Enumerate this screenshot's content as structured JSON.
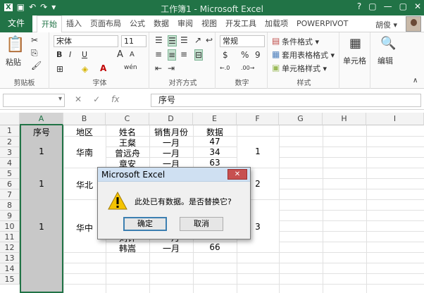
{
  "window": {
    "title": "工作簿1 - Microsoft Excel",
    "qat_icons": [
      "excel-logo-icon",
      "save-icon",
      "undo-icon",
      "redo-icon",
      "customize-icon"
    ],
    "controls": [
      "?",
      "▢",
      "—",
      "▢",
      "✕"
    ]
  },
  "ribbon_tabs": {
    "file": "文件",
    "tabs": [
      "开始",
      "插入",
      "页面布局",
      "公式",
      "数据",
      "审阅",
      "视图",
      "开发工具",
      "加载项",
      "POWERPIVOT"
    ],
    "active": "开始",
    "user": "胡俊 ▾"
  },
  "ribbon": {
    "clipboard": {
      "paste_label": "粘贴",
      "group_label": "剪贴板"
    },
    "font": {
      "font_name": "宋体",
      "font_size": "11",
      "bold": "B",
      "italic": "I",
      "underline": "U",
      "grow": "A",
      "shrink": "A",
      "wen": "wén",
      "group_label": "字体"
    },
    "alignment": {
      "group_label": "对齐方式"
    },
    "number": {
      "format": "常规",
      "currency": "$",
      "percent": "%",
      "comma": "9",
      "inc": "←.0",
      "dec": ".00→",
      "group_label": "数字"
    },
    "styles": {
      "conditional": "条件格式 ▾",
      "table": "套用表格格式 ▾",
      "cell_styles": "单元格样式 ▾",
      "group_label": "样式"
    },
    "cells": {
      "label": "单元格"
    },
    "editing": {
      "label": "编辑"
    }
  },
  "formula_bar": {
    "name_box": "",
    "cancel": "✕",
    "enter": "✓",
    "fx": "fx",
    "content": "序号"
  },
  "sheet": {
    "columns": [
      "A",
      "B",
      "C",
      "D",
      "E",
      "F",
      "G",
      "H",
      "I"
    ],
    "rows": [
      "1",
      "2",
      "3",
      "4",
      "5",
      "6",
      "7",
      "8",
      "9",
      "10",
      "11",
      "12",
      "13",
      "14",
      "15"
    ],
    "header_row": [
      "序号",
      "地区",
      "姓名",
      "销售月份",
      "数据"
    ],
    "merged_cells": [
      {
        "col": "A",
        "value": "1"
      },
      {
        "col": "A",
        "value": "1"
      },
      {
        "col": "A",
        "value": "1"
      },
      {
        "col": "B",
        "value": "华南"
      },
      {
        "col": "B",
        "value": "华北"
      },
      {
        "col": "B",
        "value": "华中"
      },
      {
        "col": "F",
        "value": "1"
      },
      {
        "col": "F",
        "value": "2"
      },
      {
        "col": "F",
        "value": "3"
      }
    ],
    "visible_rows": [
      {
        "name": "王粲",
        "month": "一月",
        "value": "47"
      },
      {
        "name": "曾远舟",
        "month": "一月",
        "value": "34"
      },
      {
        "name": "章安",
        "month": "一月",
        "value": "63"
      },
      {
        "name": "刘针",
        "month": "一月",
        "value": "44"
      },
      {
        "name": "韩嵩",
        "month": "一月",
        "value": "66"
      }
    ]
  },
  "dialog": {
    "title": "Microsoft Excel",
    "close": "✕",
    "message": "此处已有数据。是否替换它?",
    "ok": "确定",
    "cancel": "取消"
  }
}
